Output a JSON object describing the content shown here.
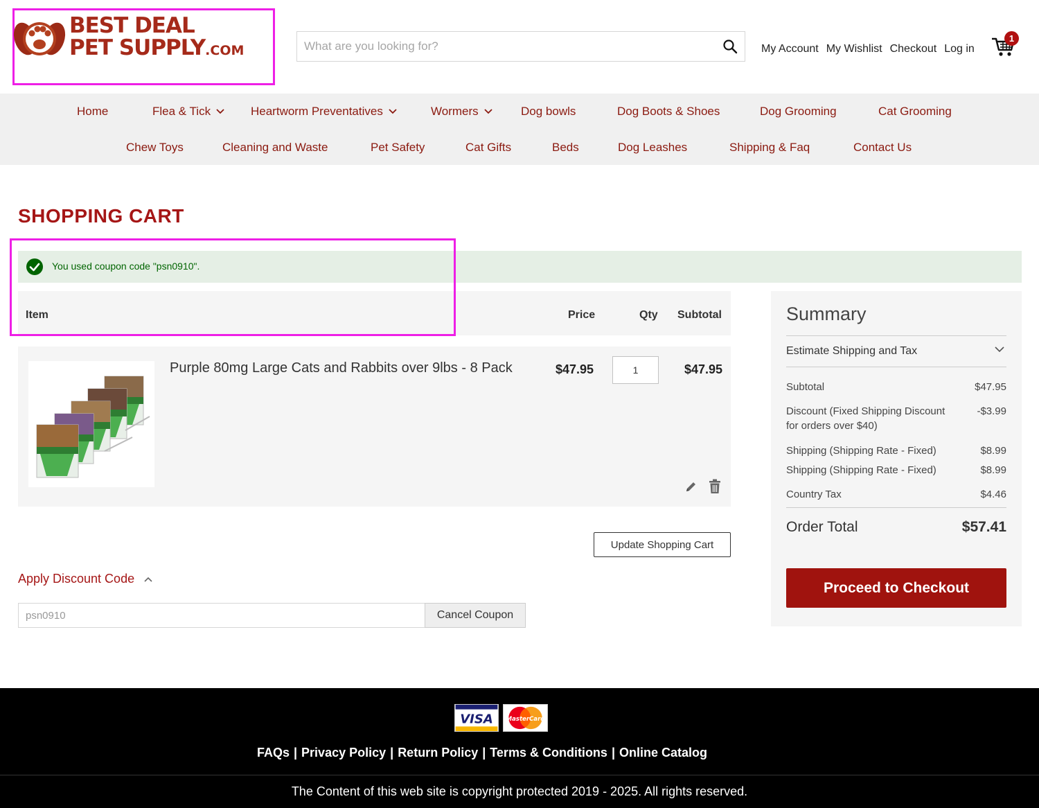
{
  "header": {
    "logo": {
      "line1": "BEST DEAL",
      "line2": "PET SUPPLY",
      "suffix": ".COM"
    },
    "search": {
      "placeholder": "What are you looking for?",
      "value": ""
    },
    "links": [
      "My Account",
      "My Wishlist",
      "Checkout",
      "Log in"
    ],
    "cart_count": "1"
  },
  "nav": {
    "row1": [
      {
        "label": "Home",
        "dropdown": false
      },
      {
        "label": "Flea & Tick",
        "dropdown": true
      },
      {
        "label": "Heartworm Preventatives",
        "dropdown": true
      },
      {
        "label": "Wormers",
        "dropdown": true
      },
      {
        "label": "Dog bowls",
        "dropdown": false
      },
      {
        "label": "Dog Boots & Shoes",
        "dropdown": false
      },
      {
        "label": "Dog Grooming",
        "dropdown": false
      },
      {
        "label": "Cat Grooming",
        "dropdown": false
      }
    ],
    "row2": [
      {
        "label": "Chew Toys"
      },
      {
        "label": "Cleaning and Waste"
      },
      {
        "label": "Pet Safety"
      },
      {
        "label": "Cat Gifts"
      },
      {
        "label": "Beds"
      },
      {
        "label": "Dog Leashes"
      },
      {
        "label": "Shipping & Faq"
      },
      {
        "label": "Contact Us"
      }
    ]
  },
  "page": {
    "title": "SHOPPING CART",
    "message": "You used coupon code \"psn0910\"."
  },
  "cart": {
    "headers": {
      "item": "Item",
      "price": "Price",
      "qty": "Qty",
      "subtotal": "Subtotal"
    },
    "items": [
      {
        "name": "Purple 80mg Large Cats and Rabbits over 9lbs - 8 Pack",
        "price": "$47.95",
        "qty": "1",
        "subtotal": "$47.95"
      }
    ],
    "update_label": "Update Shopping Cart"
  },
  "discount": {
    "toggle_label": "Apply Discount Code",
    "code_value": "psn0910",
    "cancel_label": "Cancel Coupon"
  },
  "summary": {
    "title": "Summary",
    "estimate_label": "Estimate Shipping and Tax",
    "rows": [
      {
        "label": "Subtotal",
        "value": "$47.95"
      },
      {
        "label": "Discount (Fixed Shipping Discount for orders over $40)",
        "value": "-$3.99"
      },
      {
        "label": "Shipping (Shipping Rate - Fixed)",
        "value": "$8.99"
      },
      {
        "label": "Shipping (Shipping Rate - Fixed)",
        "value": "$8.99"
      },
      {
        "label": "Country Tax",
        "value": "$4.46"
      }
    ],
    "order_total_label": "Order Total",
    "order_total_value": "$57.41",
    "checkout_label": "Proceed to Checkout"
  },
  "footer": {
    "card_logos": [
      "VISA",
      "MasterCard"
    ],
    "links": [
      "FAQs",
      "Privacy Policy",
      "Return Policy",
      "Terms & Conditions",
      "Online Catalog"
    ],
    "copyright": "The Content of this web site is copyright protected 2019 - 2025. All rights reserved."
  },
  "colors": {
    "brand": "#a51616",
    "checkout": "#a0130e",
    "highlight": "#ee1fe6",
    "success_bg": "#e5efe5",
    "success_text": "#006400"
  }
}
